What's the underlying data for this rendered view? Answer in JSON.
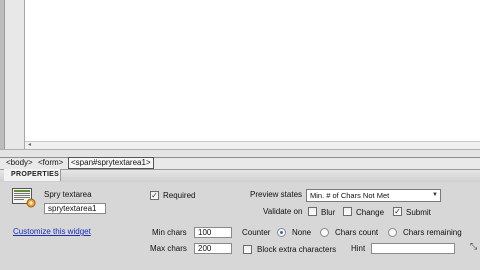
{
  "tag_selector": {
    "tags": [
      "<body>",
      "<form>",
      "<span#sprytextarea1>"
    ]
  },
  "properties": {
    "title": "PROPERTIES",
    "widget_type": "Spry textarea",
    "widget_name": "sprytextarea1",
    "customize_link": "Customize this widget",
    "required_label": "Required",
    "required_checked": true,
    "preview_states_label": "Preview states",
    "preview_states_value": "Min. # of Chars Not Met",
    "validate_on_label": "Validate on",
    "validate_options": [
      {
        "label": "Blur",
        "checked": false
      },
      {
        "label": "Change",
        "checked": false
      },
      {
        "label": "Submit",
        "checked": true
      }
    ],
    "min_chars_label": "Min chars",
    "min_chars_value": "100",
    "max_chars_label": "Max chars",
    "max_chars_value": "200",
    "counter_label": "Counter",
    "counter_options": [
      {
        "label": "None",
        "selected": true
      },
      {
        "label": "Chars count",
        "selected": false
      },
      {
        "label": "Chars remaining",
        "selected": false
      }
    ],
    "block_extra_label": "Block extra characters",
    "block_extra_checked": false,
    "hint_label": "Hint",
    "hint_value": ""
  },
  "colors": {
    "panel_bg": "#d7d7d7",
    "link": "#1a2fb8",
    "radio_selected": "#2a6db5"
  }
}
